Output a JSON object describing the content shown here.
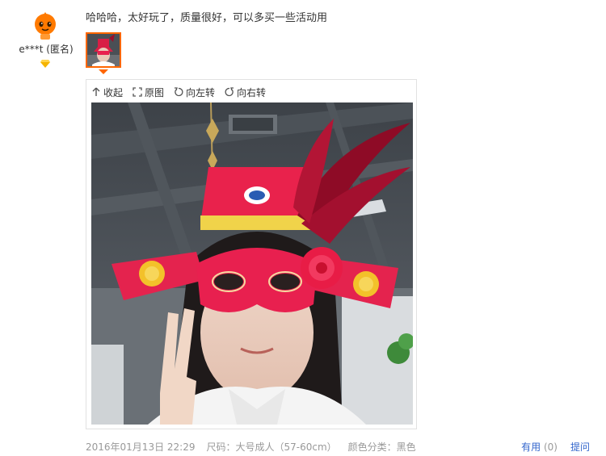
{
  "user": {
    "name": "e***t (匿名)",
    "avatar_icon": "orange-mascot-avatar",
    "badge_icon": "gold-diamond-icon"
  },
  "review": {
    "text": "哈哈哈，太好玩了，质量很好，可以多买一些活动用"
  },
  "viewer": {
    "collapse_label": "收起",
    "original_label": "原图",
    "rotate_left_label": "向左转",
    "rotate_right_label": "向右转"
  },
  "meta": {
    "date": "2016年01月13日 22:29",
    "size": "尺码：大号成人（57-60cm）",
    "color": "颜色分类：黑色"
  },
  "actions": {
    "useful_label": "有用",
    "useful_count": "(0)",
    "ask_label": "提问"
  },
  "colors": {
    "accent": "#ff6600",
    "link": "#3366cc",
    "muted": "#999999"
  }
}
